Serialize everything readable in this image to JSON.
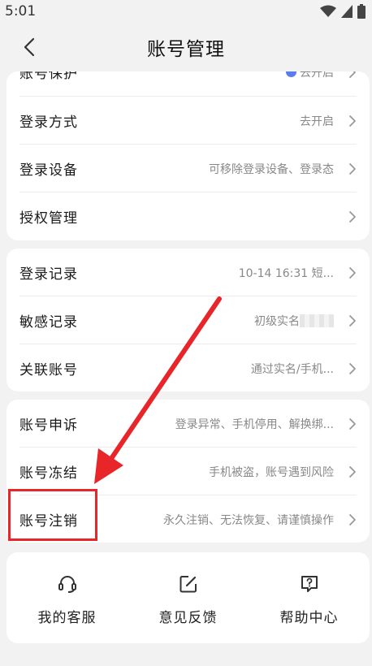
{
  "status_bar": {
    "time": "5:01"
  },
  "header": {
    "title": "账号管理"
  },
  "security_card": {
    "items": [
      {
        "label": "账号保护",
        "value": "去开启"
      },
      {
        "label": "登录方式",
        "value": "去开启"
      },
      {
        "label": "登录设备",
        "value": "可移除登录设备、登录态"
      },
      {
        "label": "授权管理",
        "value": ""
      }
    ]
  },
  "records_card": {
    "items": [
      {
        "label": "登录记录",
        "value": "10-14 16:31 短..."
      },
      {
        "label": "敏感记录",
        "value": "初级实名"
      },
      {
        "label": "关联账号",
        "value": "通过实名/手机..."
      }
    ]
  },
  "account_card": {
    "items": [
      {
        "label": "账号申诉",
        "value": "登录异常、手机停用、解换绑..."
      },
      {
        "label": "账号冻结",
        "value": "手机被盗，账号遇到风险"
      },
      {
        "label": "账号注销",
        "value": "永久注销、无法恢复、请谨慎操作"
      }
    ]
  },
  "quick_actions": [
    {
      "label": "我的客服",
      "icon": "headset-icon"
    },
    {
      "label": "意见反馈",
      "icon": "edit-icon"
    },
    {
      "label": "帮助中心",
      "icon": "help-icon"
    }
  ],
  "colors": {
    "annotation": "#e8262a",
    "badge": "#5b7cf0"
  }
}
